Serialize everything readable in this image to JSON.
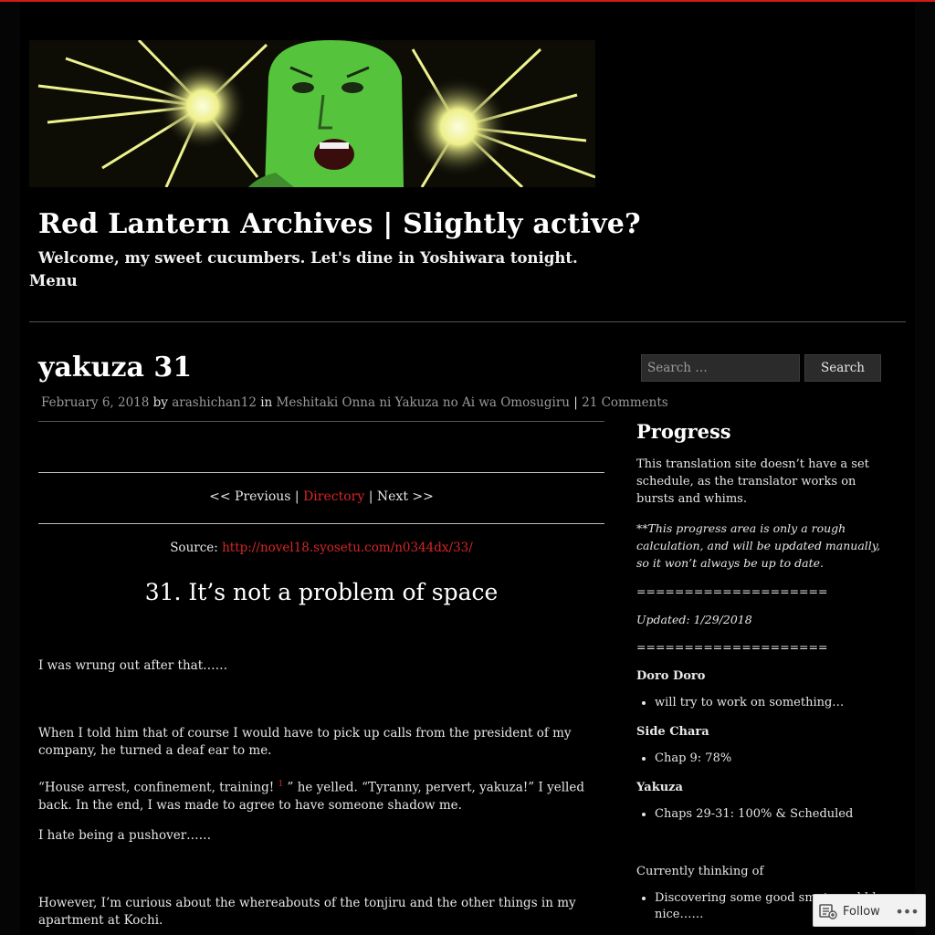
{
  "site": {
    "title": "Red Lantern Archives | Slightly active?",
    "tagline": "Welcome, my sweet cucumbers. Let's dine in Yoshiwara tonight.",
    "menu_label": "Menu"
  },
  "post": {
    "title": "yakuza 31",
    "date": "February 6, 2018",
    "by": "by",
    "author": "arashichan12",
    "in": "in",
    "category": "Meshitaki Onna ni Yakuza no Ai wa Omosugiru",
    "sep": "|",
    "comments": "21 Comments"
  },
  "nav": {
    "previous": "<< Previous",
    "sep1": "|",
    "directory": "Directory",
    "sep2": "|",
    "next": "Next >>"
  },
  "source": {
    "label": "Source:",
    "url": "http://novel18.syosetu.com/n0344dx/33/"
  },
  "chapter": {
    "title": "31. It’s not a problem of space",
    "paragraphs": {
      "p1": "I was wrung out after that……",
      "p2": "When I told him that of course I would have to pick up calls from the president of my company, he turned a deaf ear to me.",
      "p3a": "“House arrest, confinement, training!",
      "p3_footnote": "1",
      "p3b": "” he yelled. “Tyranny, pervert, yakuza!” I yelled back. In the end, I was made to agree to have someone shadow me.",
      "p4": "I hate being a pushover……",
      "p5": "However, I’m curious about the whereabouts of the tonjiru and the other things in my apartment at Kochi."
    }
  },
  "sidebar": {
    "search_placeholder": "Search …",
    "search_button": "Search",
    "progress_title": "Progress",
    "intro": "This translation site doesn’t have a set schedule, as the translator works on bursts and whims.",
    "note": "**This progress area is only a rough calculation, and will be updated manually, so it won’t always be up to date.",
    "divider1": "====================",
    "updated": "Updated: 1/29/2018",
    "divider2": "====================",
    "doro_title": "Doro Doro",
    "doro_item": "will try to work on something…",
    "side_title": "Side Chara",
    "side_item": "Chap 9: 78%",
    "yakuza_title": "Yakuza",
    "yakuza_item": "Chaps 29-31: 100% & Scheduled",
    "thinking_title": "Currently thinking of",
    "thinking_item": "Discovering some good smut would be nice……"
  },
  "follow": {
    "label": "Follow",
    "more": "•••"
  },
  "colors": {
    "accent_red": "#d62626",
    "top_bar": "#d21a1a",
    "background": "#000000",
    "banner_face": "#55c43c",
    "banner_burst": "#f4f7a0"
  }
}
